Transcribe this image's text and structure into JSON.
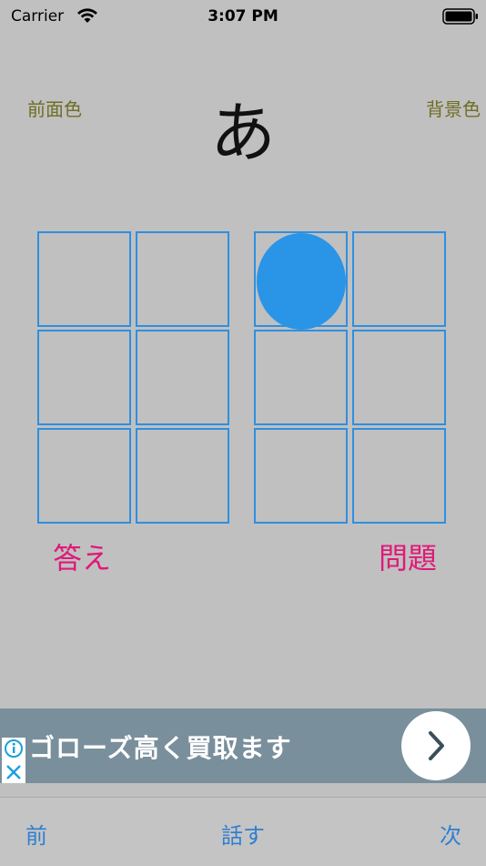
{
  "status": {
    "carrier": "Carrier",
    "time": "3:07 PM",
    "wifi_icon": "wifi-icon",
    "battery_icon": "battery-icon"
  },
  "labels": {
    "foreground_color": "前面色",
    "background_color": "背景色",
    "answer": "答え",
    "question": "問題"
  },
  "kana": "あ",
  "braille": {
    "answer_dots_raised": [
      false,
      false,
      false,
      false,
      false,
      false
    ],
    "question_dots_raised": [
      true,
      false,
      false,
      false,
      false,
      false
    ]
  },
  "ad": {
    "text": "ゴローズ高く買取ます",
    "button_icon": "chevron-right-icon",
    "info_icon": "info-icon",
    "close_icon": "close-icon"
  },
  "bottom_bar": {
    "prev": "前",
    "speak": "話す",
    "next": "次"
  },
  "colors": {
    "background": "#c0c0c0",
    "grid": "#2f8fdf",
    "dot": "#2a94e6",
    "corner_label": "#6f6d26",
    "red_label": "#e0197a",
    "link": "#2f7fd1",
    "ad_background": "#7a8f9c"
  }
}
